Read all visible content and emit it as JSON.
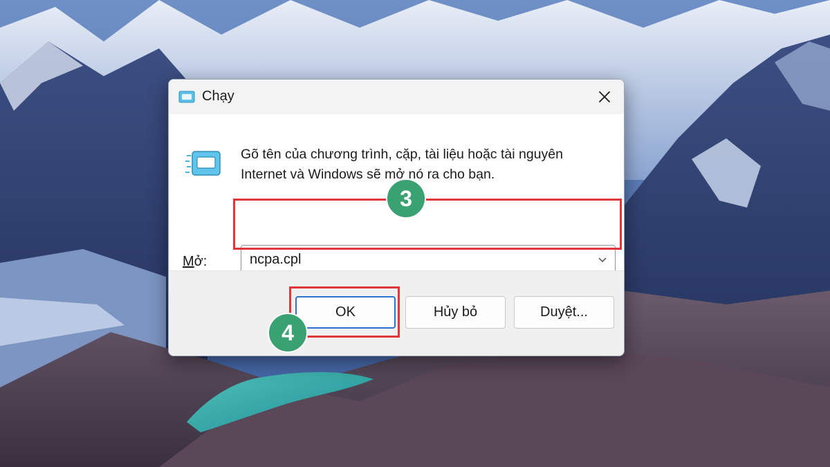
{
  "dialog": {
    "title": "Chạy",
    "description_line1": "Gõ tên của chương trình, cặp, tài liệu hoặc tài nguyên",
    "description_line2": "Internet và Windows sẽ mở nó ra cho bạn.",
    "open_label_first": "M",
    "open_label_rest": "ở:",
    "open_value": "ncpa.cpl",
    "buttons": {
      "ok": "OK",
      "cancel": "Hủy bỏ",
      "browse": "Duyệt..."
    }
  },
  "annotations": {
    "step_3": "3",
    "step_4": "4"
  },
  "colors": {
    "highlight": "#e2363b",
    "step_badge": "#3aa173",
    "focus": "#2f71d6"
  },
  "icons": [
    "run-app-icon",
    "close-icon",
    "chevron-down-icon"
  ]
}
